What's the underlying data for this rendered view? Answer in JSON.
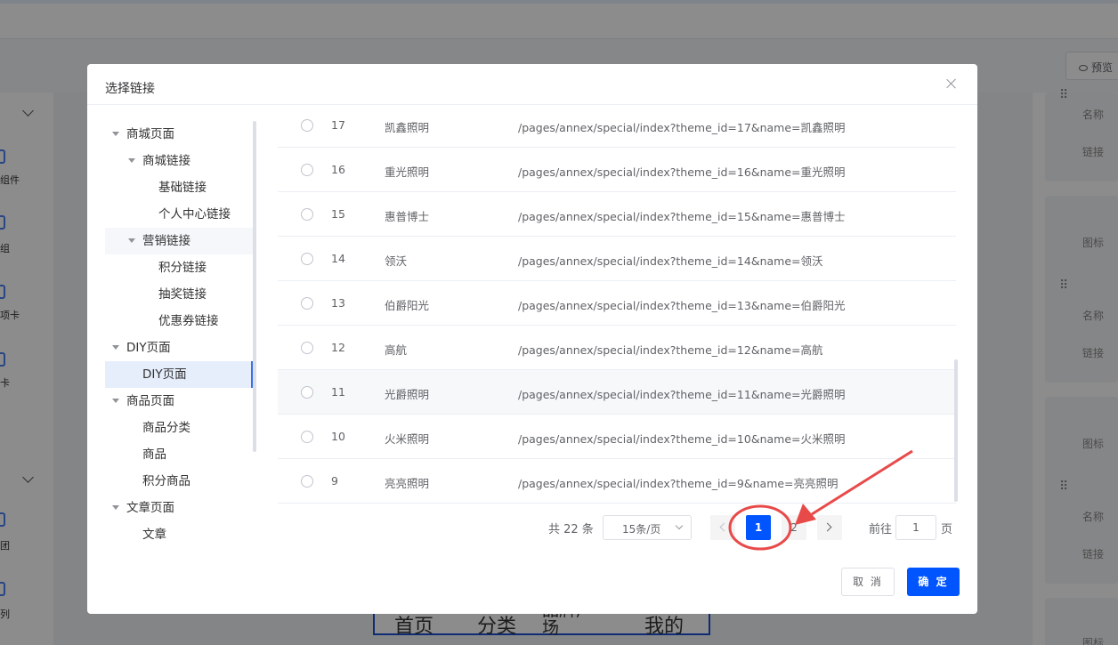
{
  "background": {
    "preview_label": "预览",
    "left_panel": {
      "items": [
        "组件",
        "组",
        "项卡",
        "卡",
        "团",
        "列"
      ]
    },
    "right_panel": {
      "labels": [
        "名称",
        "链接",
        "图标",
        "名称",
        "链接",
        "图标",
        "名称",
        "链接",
        "图标"
      ]
    },
    "tabbar": {
      "items": [
        "首页",
        "分类",
        "品牌广场",
        "我的"
      ]
    }
  },
  "dialog": {
    "title": "选择链接",
    "tree": [
      {
        "label": "商城页面",
        "level": 0,
        "expanded": true
      },
      {
        "label": "商城链接",
        "level": 1,
        "expanded": true
      },
      {
        "label": "基础链接",
        "level": 2
      },
      {
        "label": "个人中心链接",
        "level": 2
      },
      {
        "label": "营销链接",
        "level": 1,
        "expanded": true
      },
      {
        "label": "积分链接",
        "level": 2
      },
      {
        "label": "抽奖链接",
        "level": 2
      },
      {
        "label": "优惠券链接",
        "level": 2
      },
      {
        "label": "DIY页面",
        "level": 0,
        "expanded": true
      },
      {
        "label": "DIY页面",
        "level": 1,
        "selected": true
      },
      {
        "label": "商品页面",
        "level": 0,
        "expanded": true
      },
      {
        "label": "商品分类",
        "level": 1
      },
      {
        "label": "商品",
        "level": 1
      },
      {
        "label": "积分商品",
        "level": 1
      },
      {
        "label": "文章页面",
        "level": 0,
        "expanded": true
      },
      {
        "label": "文章",
        "level": 1
      }
    ],
    "rows": [
      {
        "id": "17",
        "name": "凯鑫照明",
        "link": "/pages/annex/special/index?theme_id=17&name=凯鑫照明"
      },
      {
        "id": "16",
        "name": "重光照明",
        "link": "/pages/annex/special/index?theme_id=16&name=重光照明"
      },
      {
        "id": "15",
        "name": "惠普博士",
        "link": "/pages/annex/special/index?theme_id=15&name=惠普博士"
      },
      {
        "id": "14",
        "name": "领沃",
        "link": "/pages/annex/special/index?theme_id=14&name=领沃"
      },
      {
        "id": "13",
        "name": "伯爵阳光",
        "link": "/pages/annex/special/index?theme_id=13&name=伯爵阳光"
      },
      {
        "id": "12",
        "name": "高航",
        "link": "/pages/annex/special/index?theme_id=12&name=高航"
      },
      {
        "id": "11",
        "name": "光爵照明",
        "link": "/pages/annex/special/index?theme_id=11&name=光爵照明"
      },
      {
        "id": "10",
        "name": "火米照明",
        "link": "/pages/annex/special/index?theme_id=10&name=火米照明"
      },
      {
        "id": "9",
        "name": "亮亮照明",
        "link": "/pages/annex/special/index?theme_id=9&name=亮亮照明"
      }
    ],
    "pagination": {
      "total_text": "共 22 条",
      "page_size": "15条/页",
      "pages": [
        "1",
        "2"
      ],
      "current_page": "1",
      "jump_prefix": "前往",
      "jump_value": "1",
      "jump_suffix": "页"
    },
    "buttons": {
      "cancel": "取 消",
      "confirm": "确 定"
    }
  },
  "colors": {
    "primary": "#0055ff",
    "annotation": "#e84a4a"
  },
  "icons": {
    "close": "close-icon",
    "eye": "eye-icon",
    "prev": "chevron-left-icon",
    "next": "chevron-right-icon",
    "caret": "caret-down-icon"
  }
}
